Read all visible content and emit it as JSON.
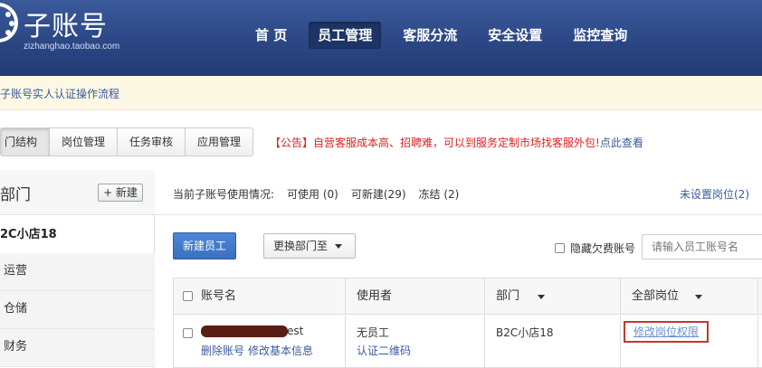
{
  "header": {
    "logo_title": "子账号",
    "logo_sub": "zizhanghao.taobao.com",
    "nav": [
      {
        "label": "首 页",
        "active": false
      },
      {
        "label": "员工管理",
        "active": true
      },
      {
        "label": "客服分流",
        "active": false
      },
      {
        "label": "安全设置",
        "active": false
      },
      {
        "label": "监控查询",
        "active": false
      }
    ]
  },
  "notice": {
    "text": "子账号实人认证操作流程"
  },
  "tabs": [
    {
      "label": "门结构",
      "active": true
    },
    {
      "label": "岗位管理",
      "active": false
    },
    {
      "label": "任务审核",
      "active": false
    },
    {
      "label": "应用管理",
      "active": false
    }
  ],
  "announcement": {
    "text": "【公告】自营客服成本高、招聘难，可以到服务定制市场找客服外包!",
    "link": "点此查看"
  },
  "left": {
    "title": "部门",
    "new_button": "+ 新建",
    "shop": "2C小店18",
    "departments": [
      "运营",
      "仓储",
      "财务"
    ]
  },
  "stats": {
    "label": "当前子账号使用情况:",
    "available": "可使用 (0)",
    "creatable": "可新建(29)",
    "frozen": "冻结 (2)",
    "unset": "未设置岗位(2)"
  },
  "toolbar": {
    "new_employee": "新建员工",
    "move_dept": "更换部门至",
    "hide_arrears": "隐藏欠费账号",
    "search_placeholder": "请输入员工账号名"
  },
  "table": {
    "headers": [
      "账号名",
      "使用者",
      "部门",
      "全部岗位"
    ],
    "rows": [
      {
        "account_suffix": "est",
        "actions": [
          "删除账号",
          "修改基本信息"
        ],
        "user": "无员工",
        "user_link": "认证二维码",
        "dept": "B2C小店18",
        "position_link": "修改岗位权限"
      }
    ]
  }
}
